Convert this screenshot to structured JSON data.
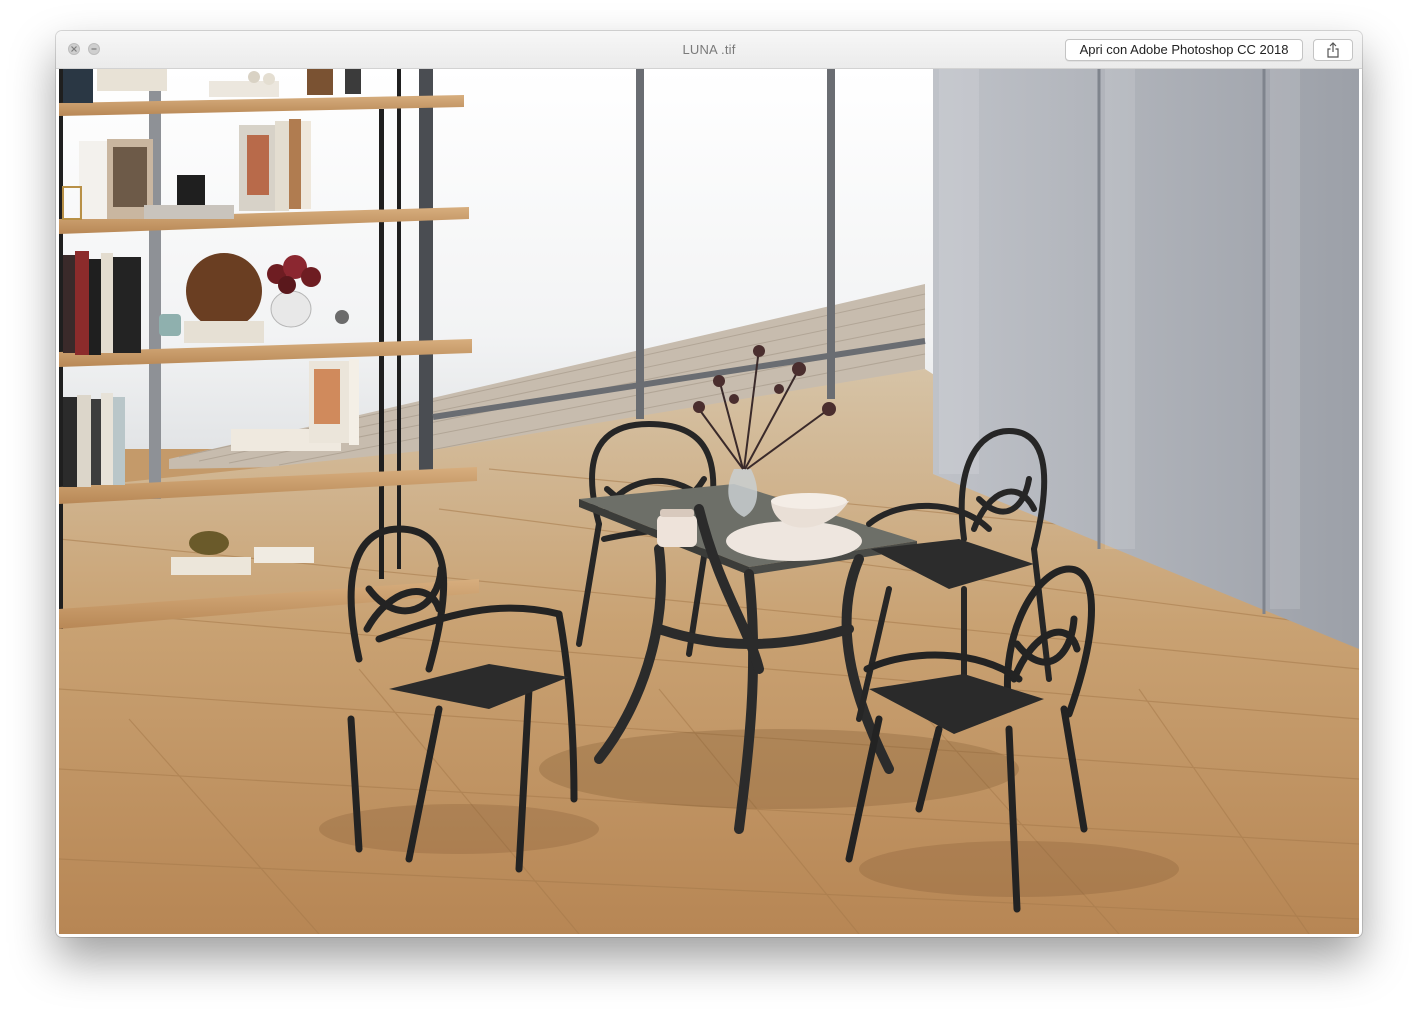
{
  "window": {
    "title": "LUNA .tif",
    "open_with_label": "Apri con Adobe Photoshop CC 2018"
  },
  "icons": {
    "close": "close-icon",
    "minimize": "minimize-icon",
    "share": "share-icon"
  },
  "colors": {
    "floor": "#c49a6a",
    "wall_panel": "#a4a8b0",
    "furniture": "#2a2a2a",
    "shelf_wood": "#c79b6b"
  }
}
